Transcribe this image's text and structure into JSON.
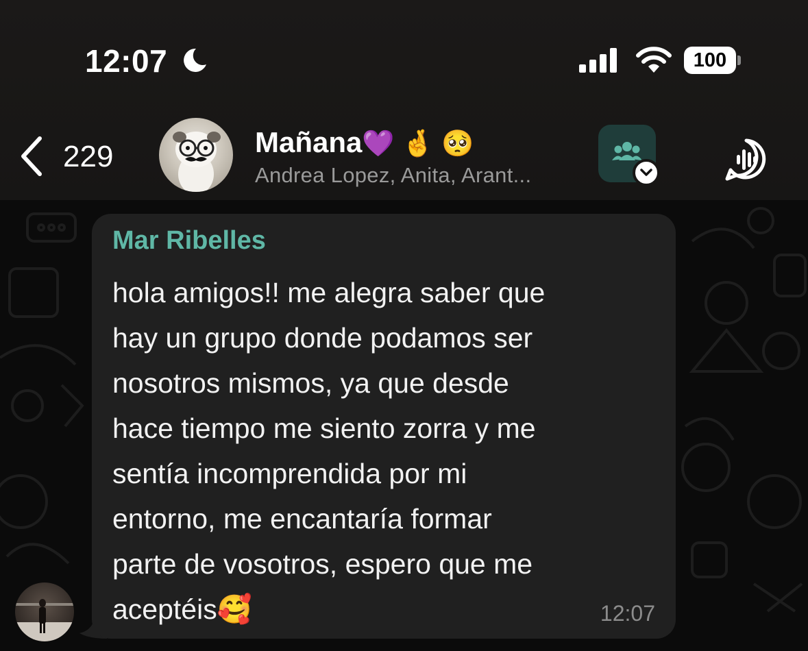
{
  "status_bar": {
    "time": "12:07",
    "battery": "100",
    "icons": [
      "moon-icon",
      "cellular-signal-icon",
      "wifi-icon",
      "battery-icon"
    ]
  },
  "nav": {
    "back_count": "229",
    "group_title": "Mañana",
    "title_emojis": "💜 🤞 🥺",
    "members": "Andrea Lopez, Anita, Arant...",
    "icons": [
      "back-chevron-icon",
      "community-icon",
      "chevron-down-icon",
      "voice-chat-icon"
    ]
  },
  "message": {
    "sender": "Mar Ribelles",
    "text": "hola amigos!! me alegra saber que\nhay un grupo donde podamos ser\nnosotros mismos, ya que desde\nhace tiempo me siento zorra y me\nsentía incomprendida por mi\nentorno, me encantaría formar\nparte de vosotros, espero que me\naceptéis🥰",
    "time": "12:07"
  },
  "colors": {
    "header_bg": "#1b1918",
    "chat_bg": "#0b0b0b",
    "bubble_bg": "#202020",
    "sender_name": "#5fb7a6",
    "community_button": "#1f3d3a"
  }
}
